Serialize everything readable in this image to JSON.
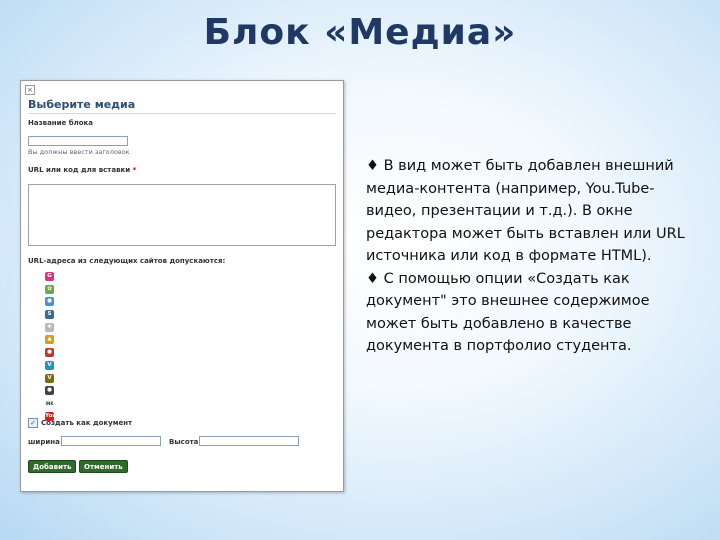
{
  "slide": {
    "title": "Блок «Медиа»"
  },
  "panel": {
    "close_glyph": "×",
    "heading": "Выберите медиа",
    "block_name_label": "Название блока",
    "block_name_hint": "Вы должны ввести заголовок",
    "url_label": "URL или код для вставки",
    "required_mark": "*",
    "allowed_sites_label": "URL-адреса из следующих сайтов допускаются:",
    "sites": [
      {
        "icon": "flickr-icon",
        "glyph": "G",
        "color": "#d9367a"
      },
      {
        "icon": "picasa-icon",
        "glyph": "✿",
        "color": "#6aa84f"
      },
      {
        "icon": "google-icon",
        "glyph": "●",
        "color": "#4a90d9"
      },
      {
        "icon": "slideshare-icon",
        "glyph": "S",
        "color": "#3c6e8f"
      },
      {
        "icon": "wikimedia-icon",
        "glyph": "✻",
        "color": "#b9b9b9"
      },
      {
        "icon": "android-icon",
        "glyph": "▲",
        "color": "#c9a227"
      },
      {
        "icon": "apple-icon",
        "glyph": "●",
        "color": "#c0392b"
      },
      {
        "icon": "vimeo-icon",
        "glyph": "V",
        "color": "#2a8fbd"
      },
      {
        "icon": "viddler-icon",
        "glyph": "V",
        "color": "#7a6a10"
      },
      {
        "icon": "blip-icon",
        "glyph": "●",
        "color": "#444444"
      },
      {
        "icon": "ink-icon",
        "glyph": "INK",
        "color": "#ffffff",
        "text_color": "#333333"
      },
      {
        "icon": "youtube-icon",
        "glyph": "You",
        "color": "#cc2222"
      }
    ],
    "create_doc_label": "Создать как документ",
    "create_doc_checked": "✓",
    "width_label": "ширина",
    "height_label": "Высота",
    "add_button": "Добавить",
    "cancel_button": "Отменить"
  },
  "description": {
    "paragraph1": "♦ В вид может быть добавлен внешний медиа-контента (например, You.Tube-видео, презентации и т.д.). В окне редактора может быть вставлен или URL источника или код в формате HTML).",
    "paragraph2": "♦ С помощью опции «Создать как документ\" это внешнее содержимое может быть добавлено в качестве документа в портфолио студента."
  }
}
